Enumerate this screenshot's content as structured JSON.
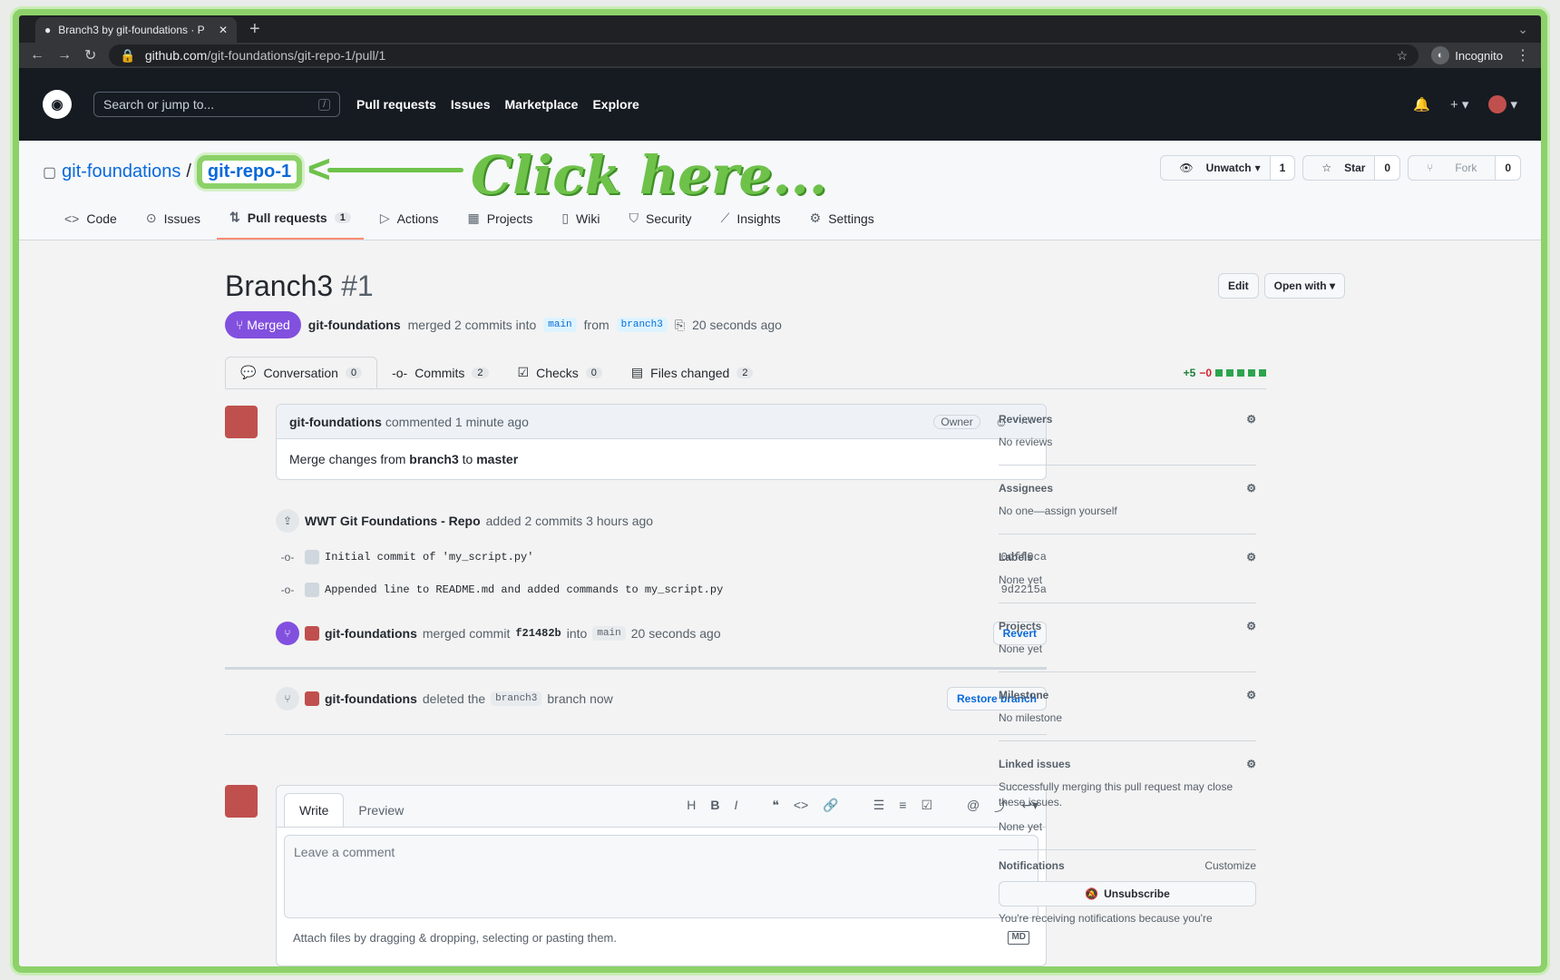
{
  "browser": {
    "tab_title": "Branch3 by git-foundations · P",
    "url_host": "github.com",
    "url_path": "/git-foundations/git-repo-1/pull/1",
    "incognito_label": "Incognito"
  },
  "gh_header": {
    "search_placeholder": "Search or jump to...",
    "search_key": "/",
    "nav": [
      "Pull requests",
      "Issues",
      "Marketplace",
      "Explore"
    ]
  },
  "repo": {
    "owner": "git-foundations",
    "separator": "/",
    "name": "git-repo-1",
    "annotation": "Click here...",
    "unwatch_label": "Unwatch",
    "unwatch_count": "1",
    "star_label": "Star",
    "star_count": "0",
    "fork_label": "Fork",
    "fork_count": "0",
    "tabs": [
      {
        "label": "Code",
        "icon": "code-icon"
      },
      {
        "label": "Issues",
        "icon": "issue-icon"
      },
      {
        "label": "Pull requests",
        "icon": "pr-icon",
        "count": "1"
      },
      {
        "label": "Actions",
        "icon": "play-icon"
      },
      {
        "label": "Projects",
        "icon": "table-icon"
      },
      {
        "label": "Wiki",
        "icon": "book-icon"
      },
      {
        "label": "Security",
        "icon": "shield-icon"
      },
      {
        "label": "Insights",
        "icon": "graph-icon"
      },
      {
        "label": "Settings",
        "icon": "gear-icon"
      }
    ]
  },
  "pr": {
    "title": "Branch3",
    "number": "#1",
    "edit_label": "Edit",
    "open_with_label": "Open with",
    "state": "Merged",
    "author": "git-foundations",
    "merge_text": "merged 2 commits into",
    "base": "main",
    "from_text": "from",
    "head": "branch3",
    "time": "20 seconds ago",
    "tabs": [
      {
        "label": "Conversation",
        "count": "0"
      },
      {
        "label": "Commits",
        "count": "2"
      },
      {
        "label": "Checks",
        "count": "0"
      },
      {
        "label": "Files changed",
        "count": "2"
      }
    ],
    "additions": "+5",
    "deletions": "−0"
  },
  "comment": {
    "author": "git-foundations",
    "meta": "commented 1 minute ago",
    "role": "Owner",
    "body_pre": "Merge changes from",
    "body_branch": "branch3",
    "body_mid": "to",
    "body_target": "master"
  },
  "timeline": {
    "commits_actor": "WWT Git Foundations - Repo",
    "commits_text": "added 2 commits 3 hours ago",
    "commits": [
      {
        "message": "Initial commit of 'my_script.py'",
        "sha": "0dff0ca"
      },
      {
        "message": "Appended line to README.md and added commands to my_script.py",
        "sha": "9d2215a"
      }
    ],
    "merge_actor": "git-foundations",
    "merge_text": "merged commit",
    "merge_sha": "f21482b",
    "merge_into": "into",
    "merge_base": "main",
    "merge_time": "20 seconds ago",
    "revert_label": "Revert",
    "delete_actor": "git-foundations",
    "delete_text": "deleted the",
    "delete_branch": "branch3",
    "delete_suffix": "branch now",
    "restore_label": "Restore branch"
  },
  "editor": {
    "write_tab": "Write",
    "preview_tab": "Preview",
    "placeholder": "Leave a comment",
    "attach_text": "Attach files by dragging & dropping, selecting or pasting them.",
    "md_badge": "MD"
  },
  "sidebar": {
    "reviewers_h": "Reviewers",
    "reviewers_v": "No reviews",
    "assignees_h": "Assignees",
    "assignees_v": "No one—assign yourself",
    "labels_h": "Labels",
    "labels_v": "None yet",
    "projects_h": "Projects",
    "projects_v": "None yet",
    "milestone_h": "Milestone",
    "milestone_v": "No milestone",
    "linked_h": "Linked issues",
    "linked_v": "Successfully merging this pull request may close these issues.",
    "linked_v2": "None yet",
    "notif_h": "Notifications",
    "customize": "Customize",
    "unsubscribe": "Unsubscribe",
    "notif_note": "You're receiving notifications because you're"
  },
  "colors": {
    "accent": "#0969da",
    "merged": "#8250df",
    "highlight": "#8cd16a"
  }
}
